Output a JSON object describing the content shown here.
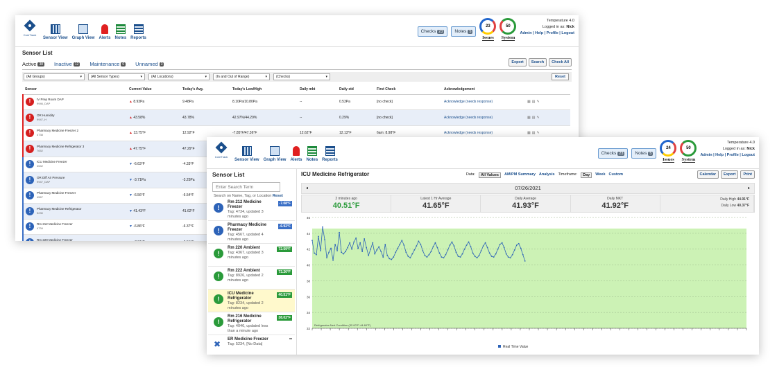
{
  "nav": {
    "logo_text": "CoreTrack",
    "items": [
      {
        "label": "Sensor View",
        "icon": "sensor-view-icon"
      },
      {
        "label": "Graph View",
        "icon": "graph-view-icon"
      },
      {
        "label": "Alerts",
        "icon": "siren-icon"
      },
      {
        "label": "Notes",
        "icon": "notes-icon"
      },
      {
        "label": "Reports",
        "icon": "reports-icon"
      }
    ]
  },
  "w1": {
    "checks_label": "Checks",
    "checks_count": "23",
    "notes_label": "Notes",
    "notes_count": "5",
    "issues_value": "23",
    "issues_label": "Issues",
    "system_value": "50",
    "system_label": "System",
    "version": "Temperature 4.0",
    "logged_prefix": "Logged in as: ",
    "user": "Nick",
    "links": "Admin | Help | Profile | Logout",
    "title": "Sensor List",
    "tabs": [
      {
        "label": "Active",
        "count": "38"
      },
      {
        "label": "Inactive",
        "count": "12"
      },
      {
        "label": "Maintenance",
        "count": "0"
      },
      {
        "label": "Unnamed",
        "count": "3"
      }
    ],
    "tools": [
      "Export",
      "Search",
      "Check All"
    ],
    "filters": [
      "(All Groups)",
      "(All Sensor Types)",
      "(All Locations)",
      "(In and Out of Range)",
      "(Checks)"
    ],
    "reset": "Reset",
    "columns": [
      "Sensor",
      "Current Value",
      "Today's Avg.",
      "Today's Low/High",
      "Daily mkt",
      "Daily std",
      "First Check",
      "Acknowledgement"
    ],
    "rows": [
      {
        "name": "IV Prep Room DAP",
        "tag": "9946_DAP",
        "cur": "8.93Pa",
        "avg": "9.48Pa",
        "lh": "8.10Pa/10.80Pa",
        "mkt": "--",
        "std": "0.53Pa",
        "fc": "[no check]",
        "ack": "Acknowledge (needs response)",
        "status": "red"
      },
      {
        "name": "OR Humidity",
        "tag": "9947_H",
        "cur": "43.58%",
        "avg": "43.78%",
        "lh": "42.97%/44.29%",
        "mkt": "--",
        "std": "0.29%",
        "fc": "[no check]",
        "ack": "Acknowledge (needs response)",
        "status": "red"
      },
      {
        "name": "Pharmacy Medicine Freezer 2",
        "tag": "4738",
        "cur": "13.75°F",
        "avg": "12.92°F",
        "lh": "-7.85°F/47.36°F",
        "mkt": "12.62°F",
        "std": "12.13°F",
        "fc": "6am: 8.98°F",
        "ack": "Acknowledge (needs response)",
        "status": "red"
      },
      {
        "name": "Pharmacy Medicine Refrigerator 3",
        "tag": "7652",
        "cur": "47.75°F",
        "avg": "47.29°F",
        "lh": "",
        "mkt": "",
        "std": "",
        "fc": "",
        "ack": "",
        "status": "red"
      },
      {
        "name": "ICU Medicine Freezer",
        "tag": "4542",
        "cur": "-6.63°F",
        "avg": "-4.33°F",
        "lh": "",
        "mkt": "",
        "std": "",
        "fc": "",
        "ack": "",
        "status": "blue"
      },
      {
        "name": "OR Diff Air Pressure",
        "tag": "9947_DAP",
        "cur": "-3.71Pa",
        "avg": "-3.25Pa",
        "lh": "",
        "mkt": "",
        "std": "",
        "fc": "",
        "ack": "",
        "status": "blue"
      },
      {
        "name": "Pharmacy Medicine Freezer",
        "tag": "4567",
        "cur": "-6.56°F",
        "avg": "-6.54°F",
        "lh": "",
        "mkt": "",
        "std": "",
        "fc": "",
        "ack": "",
        "status": "blue"
      },
      {
        "name": "Pharmacy Medicine Refrigerator",
        "tag": "5230",
        "cur": "41.43°F",
        "avg": "41.62°F",
        "lh": "",
        "mkt": "",
        "std": "",
        "fc": "",
        "ack": "",
        "status": "blue"
      },
      {
        "name": "Rm 212 Medicine Freezer",
        "tag": "4734",
        "cur": "-6.86°F",
        "avg": "-6.37°F",
        "lh": "",
        "mkt": "",
        "std": "",
        "fc": "",
        "ack": "",
        "status": "blue"
      },
      {
        "name": "Rm 220 Medicine Freezer",
        "tag": "4463",
        "cur": "-7.01°F",
        "avg": "-6.51°F",
        "lh": "",
        "mkt": "",
        "std": "",
        "fc": "",
        "ack": "",
        "status": "blue"
      }
    ]
  },
  "w2": {
    "checks_label": "Checks",
    "checks_count": "23",
    "notes_label": "Notes",
    "notes_count": "5",
    "issues_value": "24",
    "issues_label": "Issues",
    "system_value": "50",
    "system_label": "System",
    "version": "Temperature 4.0",
    "logged_prefix": "Logged in as: ",
    "user": "Nick",
    "links": "Admin | Help | Profile | Logout",
    "list_title": "Sensor List",
    "search_placeholder": "Enter Search Term",
    "search_hint": "Search on Name, Tag, or Location",
    "search_reset": "Reset",
    "list": [
      {
        "name": "Rm 212 Medicine Freezer",
        "tag": "Tag: 4734, updated 3 minutes ago",
        "value": "-7.08°F",
        "color": "blue"
      },
      {
        "name": "Pharmacy Medicine Freezer",
        "tag": "Tag: 4567, updated 4 minutes ago",
        "value": "-6.92°F",
        "color": "blue"
      },
      {
        "name": "Rm 220 Ambient",
        "tag": "Tag: 4367, updated 3 minutes ago",
        "value": "72.59°F",
        "color": "green"
      },
      {
        "name": "Rm 222 Ambient",
        "tag": "Tag: 8926, updated 2 minutes ago",
        "value": "73.20°F",
        "color": "green"
      },
      {
        "name": "ICU Medicine Refrigerator",
        "tag": "Tag: 8234, updated 2 minutes ago",
        "value": "40.51°F",
        "color": "green",
        "selected": true
      },
      {
        "name": "Rm 216 Medicine Refrigerator",
        "tag": "Tag: 4046, updated less than a minute ago",
        "value": "38.02°F",
        "color": "green"
      },
      {
        "name": "ER Medicine Freezer",
        "tag": "Tag: 5234, [No Data]",
        "value": "",
        "color": "gray",
        "wrench": true
      }
    ],
    "detail_title": "ICU Medicine Refrigerator",
    "data_label": "Data:",
    "data_opts": [
      "All Values",
      "AM/PM Summary",
      "Analysis"
    ],
    "timeframe_label": "Timeframe:",
    "timeframe_opts": [
      "Day",
      "Week",
      "Custom"
    ],
    "buttons": [
      "Calendar",
      "Export",
      "Print"
    ],
    "date": "07/26/2021",
    "stats": [
      {
        "label": "2 minutes ago",
        "value": "40.51°F"
      },
      {
        "label": "Latest 1 Hr Average",
        "value": "41.65°F"
      },
      {
        "label": "Daily Average",
        "value": "41.93°F"
      },
      {
        "label": "Daily MKT",
        "value": "41.92°F"
      }
    ],
    "daily_high_label": "Daily High",
    "daily_high": "44.91°F",
    "daily_low_label": "Daily Low",
    "daily_low": "40.37°F"
  },
  "chart_data": {
    "type": "line",
    "ylim": [
      32,
      46
    ],
    "yticks": [
      32,
      34,
      36,
      38,
      40,
      42,
      44,
      46
    ],
    "alert_band": [
      32,
      44.6
    ],
    "alert_label": "Refrigerator Alert Condition (32.00°F-44.60°F)",
    "band_color": "#ccf2b5",
    "line_color": "#2d63b8",
    "series": [
      {
        "name": "Real Time Value",
        "values": [
          43.1,
          41.5,
          41.3,
          43.6,
          41.8,
          44.8,
          43.2,
          40.9,
          41.6,
          42.1,
          40.6,
          42.6,
          41.8,
          44.1,
          41.6,
          41.4,
          41.7,
          42.2,
          42.8,
          42.0,
          42.9,
          43.4,
          42.1,
          42.8,
          41.7,
          43.3,
          42.2,
          41.2,
          42.0,
          42.8,
          41.4,
          41.9,
          42.3,
          41.7,
          41.0,
          42.6,
          41.2,
          40.8,
          40.7,
          41.0,
          41.6,
          42.1,
          42.6,
          43.1,
          42.5,
          41.6,
          41.1,
          40.9,
          41.4,
          41.9,
          42.4,
          43.0,
          42.6,
          41.8,
          41.2,
          41.0,
          41.3,
          41.7,
          42.3,
          42.8,
          42.2,
          41.5,
          41.0,
          40.9,
          41.3,
          41.9,
          42.5,
          42.9,
          42.4,
          41.6,
          41.1,
          41.0,
          41.4,
          42.0,
          42.5,
          42.9,
          42.3,
          41.5,
          41.1,
          40.9,
          41.2,
          41.8,
          42.4,
          42.8,
          42.2,
          41.5,
          41.1,
          41.0,
          41.4,
          42.0,
          42.6,
          42.8,
          42.2,
          41.4,
          41.0,
          40.9,
          41.3,
          41.9,
          42.5,
          42.7,
          42.1,
          41.3,
          40.5
        ]
      }
    ]
  }
}
